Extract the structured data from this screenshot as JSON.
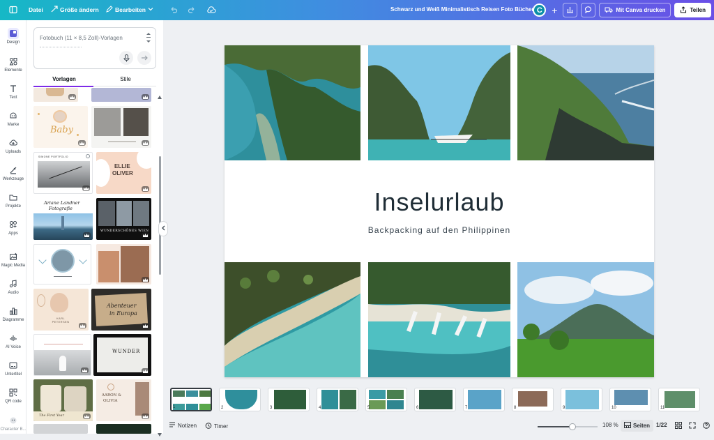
{
  "topbar": {
    "menu_icon": "sidebar-toggle-icon",
    "file_label": "Datei",
    "resize_label": "Größe ändern",
    "edit_label": "Bearbeiten",
    "title": "Schwarz und Weiß Minimalistisch Reisen Foto Bücher",
    "avatar_letter": "C",
    "print_label": "Mit Canva drucken",
    "share_label": "Teilen"
  },
  "nav": {
    "items": [
      {
        "label": "Design",
        "icon": "design-icon"
      },
      {
        "label": "Elemente",
        "icon": "elements-icon"
      },
      {
        "label": "Text",
        "icon": "text-icon"
      },
      {
        "label": "Marke",
        "icon": "brand-icon"
      },
      {
        "label": "Uploads",
        "icon": "upload-icon"
      },
      {
        "label": "Werkzeuge",
        "icon": "tools-icon"
      },
      {
        "label": "Projekte",
        "icon": "folder-icon"
      },
      {
        "label": "Apps",
        "icon": "apps-icon"
      },
      {
        "label": "Magic Media",
        "icon": "magic-media-icon"
      },
      {
        "label": "Audio",
        "icon": "music-icon"
      },
      {
        "label": "Diagramme",
        "icon": "chart-icon"
      },
      {
        "label": "AI Voice",
        "icon": "microphone-icon"
      },
      {
        "label": "Untertitel",
        "icon": "subtitles-icon"
      },
      {
        "label": "QR code",
        "icon": "qr-icon"
      },
      {
        "label": "Character B...",
        "icon": "character-icon"
      }
    ]
  },
  "panel": {
    "search_placeholder": "Fotobuch (11 × 8,5 Zoll)-Vorlagen",
    "tab_templates": "Vorlagen",
    "tab_styles": "Stile",
    "thumb_texts": {
      "baby": "Baby",
      "ellie": "ELLIE",
      "oliver": "OLIVER",
      "ariane_line1": "Ariane Landner",
      "ariane_line2": "Fotografie",
      "wien": "WUNDERSCHÖNES WIEN",
      "abenteuer_line1": "Abenteuer",
      "abenteuer_line2": "in Europa",
      "wunder": "WUNDER",
      "aaron": "AARON &",
      "olivia": "OLIVIA",
      "first_year": "The First Year",
      "portfolio": "SIMONE PORTFOLIO",
      "karl": "KARL PETERSEN"
    }
  },
  "canvas": {
    "title": "Inselurlaub",
    "subtitle": "Backpacking auf den Philippinen"
  },
  "pages": [
    "1",
    "2",
    "3",
    "4",
    "5",
    "6",
    "7",
    "8",
    "9",
    "10",
    "11"
  ],
  "footer": {
    "notes_label": "Notizen",
    "timer_label": "Timer",
    "zoom_label": "108 %",
    "zoom_fraction": 0.58,
    "pages_label": "Seiten",
    "page_counter": "1/22"
  }
}
